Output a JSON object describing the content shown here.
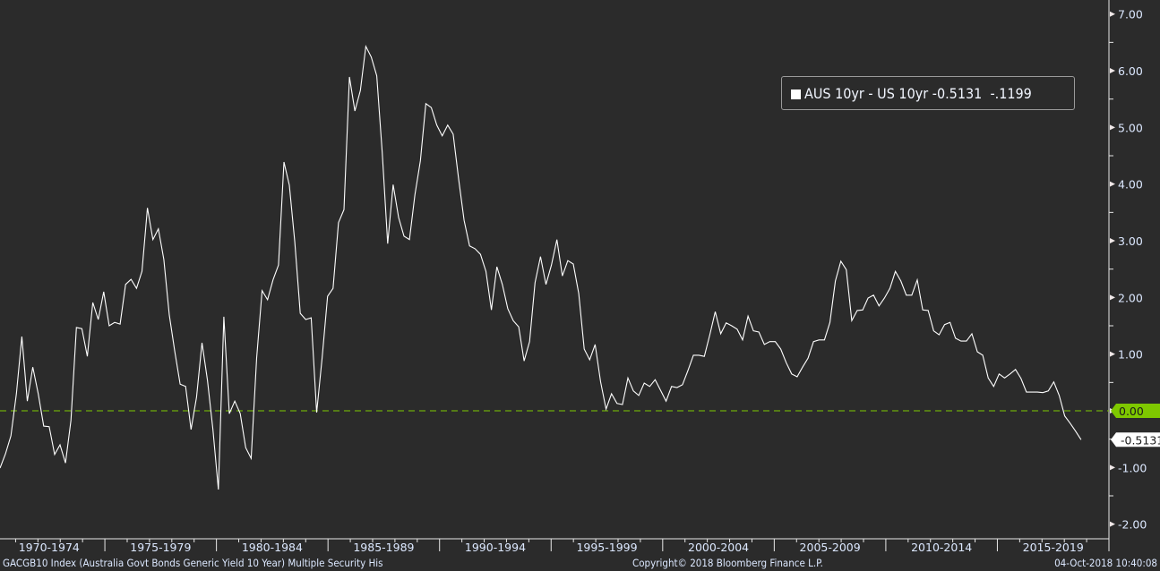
{
  "chart_data": {
    "type": "line",
    "title": "",
    "xlabel": "",
    "ylabel": "",
    "x_start": 1970.3,
    "x_end": 2018.75,
    "xlim": [
      1970.3,
      2020.0
    ],
    "ylim": [
      -2.25,
      7.25
    ],
    "grid": false,
    "legend_position": "top-right",
    "x_tick_labels": [
      "1970-1974",
      "1975-1979",
      "1980-1984",
      "1985-1989",
      "1990-1994",
      "1995-1999",
      "2000-2004",
      "2005-2009",
      "2010-2014",
      "2015-2019"
    ],
    "y_ticks": [
      7,
      6,
      5,
      4,
      3,
      2,
      1,
      0,
      -1,
      -2
    ],
    "y_tick_labels": [
      "7.00",
      "6.00",
      "5.00",
      "4.00",
      "3.00",
      "2.00",
      "1.00",
      "0.00",
      "-1.00",
      "-2.00"
    ],
    "reference_line": {
      "value": 0,
      "label": "0.00",
      "color": "#7ec800"
    },
    "last_value_label": "-0.5131",
    "series": [
      {
        "name": "AUS 10yr - US 10yr",
        "color": "#ffffff",
        "values": [
          -1.01,
          -0.76,
          -0.44,
          0.3,
          1.31,
          0.17,
          0.77,
          0.3,
          -0.27,
          -0.28,
          -0.77,
          -0.6,
          -0.92,
          -0.17,
          1.47,
          1.45,
          0.96,
          1.91,
          1.61,
          2.1,
          1.5,
          1.56,
          1.53,
          2.23,
          2.32,
          2.16,
          2.46,
          3.58,
          3.02,
          3.21,
          2.67,
          1.69,
          1.06,
          0.47,
          0.43,
          -0.33,
          0.24,
          1.2,
          0.54,
          -0.33,
          -1.39,
          1.66,
          -0.05,
          0.17,
          -0.05,
          -0.65,
          -0.84,
          0.93,
          2.12,
          1.96,
          2.31,
          2.57,
          4.39,
          3.98,
          2.98,
          1.72,
          1.61,
          1.64,
          -0.03,
          0.93,
          2.02,
          2.16,
          3.32,
          3.55,
          5.89,
          5.29,
          5.65,
          6.43,
          6.24,
          5.91,
          4.56,
          2.95,
          3.99,
          3.41,
          3.08,
          3.02,
          3.81,
          4.41,
          5.42,
          5.35,
          5.04,
          4.85,
          5.04,
          4.88,
          4.09,
          3.36,
          2.91,
          2.86,
          2.76,
          2.46,
          1.78,
          2.54,
          2.23,
          1.8,
          1.59,
          1.48,
          0.88,
          1.22,
          2.26,
          2.72,
          2.23,
          2.57,
          3.02,
          2.38,
          2.65,
          2.59,
          2.07,
          1.09,
          0.9,
          1.17,
          0.51,
          0.03,
          0.3,
          0.13,
          0.11,
          0.58,
          0.35,
          0.27,
          0.49,
          0.43,
          0.55,
          0.36,
          0.17,
          0.43,
          0.41,
          0.46,
          0.71,
          0.98,
          0.98,
          0.96,
          1.34,
          1.75,
          1.36,
          1.55,
          1.5,
          1.44,
          1.25,
          1.67,
          1.41,
          1.39,
          1.17,
          1.22,
          1.22,
          1.09,
          0.85,
          0.65,
          0.6,
          0.77,
          0.93,
          1.22,
          1.25,
          1.25,
          1.56,
          2.29,
          2.64,
          2.49,
          1.59,
          1.77,
          1.78,
          1.99,
          2.04,
          1.85,
          1.99,
          2.16,
          2.46,
          2.29,
          2.04,
          2.04,
          2.31,
          1.78,
          1.77,
          1.41,
          1.34,
          1.52,
          1.56,
          1.28,
          1.23,
          1.23,
          1.36,
          1.04,
          0.98,
          0.58,
          0.43,
          0.65,
          0.58,
          0.65,
          0.73,
          0.57,
          0.33,
          0.33,
          0.33,
          0.32,
          0.35,
          0.51,
          0.27,
          -0.09,
          -0.22,
          -0.36,
          -0.51
        ]
      }
    ]
  },
  "legend": {
    "label": "AUS 10yr - US 10yr",
    "last": "-0.5131",
    "avg": "-.1199"
  },
  "footer": {
    "security": "GACGB10 Index (Australia Govt Bonds Generic Yield 10 Year) Multiple Security His",
    "copyright": "Copyright© 2018 Bloomberg Finance L.P.",
    "timestamp": "04-Oct-2018 10:40:08"
  }
}
